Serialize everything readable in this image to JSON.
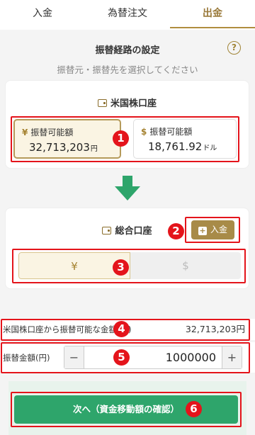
{
  "tabs": [
    {
      "label": "入金",
      "active": false
    },
    {
      "label": "為替注文",
      "active": false
    },
    {
      "label": "出金",
      "active": true
    }
  ],
  "section": {
    "title": "振替経路の設定",
    "subtitle": "振替元・振替先を選択してください",
    "help_icon": "?"
  },
  "source_account": {
    "name": "米国株口座",
    "yen": {
      "symbol": "¥",
      "label": "振替可能額",
      "value": "32,713,203",
      "unit": "円"
    },
    "usd": {
      "symbol": "$",
      "label": "振替可能額",
      "value": "18,761.92",
      "unit": "ドル"
    }
  },
  "dest_account": {
    "name": "総合口座",
    "deposit_button": "入金",
    "currency_options": [
      "¥",
      "$"
    ],
    "selected_currency": "¥"
  },
  "transfer_info": {
    "label": "米国株口座から振替可能な金額(円)",
    "value": "32,713,203円"
  },
  "amount": {
    "label": "振替金額(円)",
    "value": "1000000",
    "minus": "−",
    "plus": "+"
  },
  "next_button": "次へ（資金移動額の確認）",
  "annotations": [
    "1",
    "2",
    "3",
    "4",
    "5",
    "6"
  ],
  "colors": {
    "accent_gold": "#b08d3e",
    "primary_green": "#2ea56b",
    "annotation_red": "#e4141b"
  }
}
